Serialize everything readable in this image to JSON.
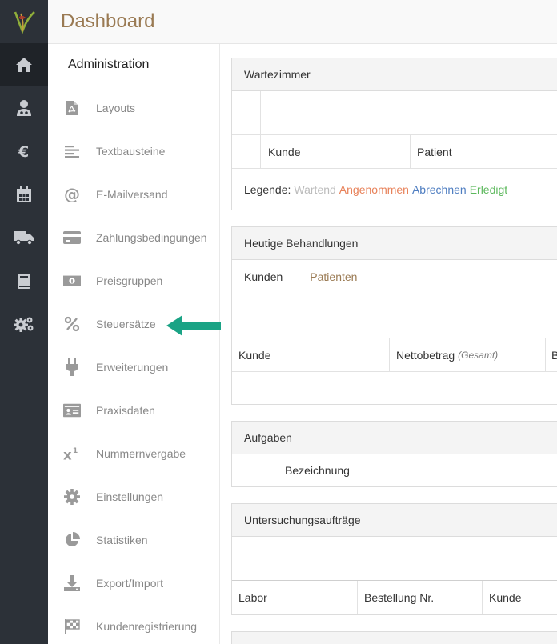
{
  "header": {
    "title": "Dashboard"
  },
  "submenu": {
    "heading": "Administration",
    "items": [
      {
        "label": "Layouts",
        "icon": "pdf-file-icon"
      },
      {
        "label": "Textbausteine",
        "icon": "text-lines-icon"
      },
      {
        "label": "E-Mailversand",
        "icon": "at-sign-icon"
      },
      {
        "label": "Zahlungsbedingungen",
        "icon": "credit-card-icon"
      },
      {
        "label": "Preisgruppen",
        "icon": "money-bill-icon"
      },
      {
        "label": "Steuersätze",
        "icon": "percent-icon"
      },
      {
        "label": "Erweiterungen",
        "icon": "plug-icon"
      },
      {
        "label": "Praxisdaten",
        "icon": "id-card-icon"
      },
      {
        "label": "Nummernvergabe",
        "icon": "superscript-icon"
      },
      {
        "label": "Einstellungen",
        "icon": "gear-icon"
      },
      {
        "label": "Statistiken",
        "icon": "pie-chart-icon"
      },
      {
        "label": "Export/Import",
        "icon": "download-icon"
      },
      {
        "label": "Kundenregistrierung",
        "icon": "checkered-flag-icon"
      }
    ]
  },
  "rail": [
    "logo-icon",
    "home-icon",
    "user-doctor-icon",
    "euro-icon",
    "calendar-icon",
    "truck-icon",
    "book-icon",
    "cogs-icon"
  ],
  "wartezimmer": {
    "title": "Wartezimmer",
    "columns": [
      "Kunde",
      "Patient"
    ],
    "legend_label": "Legende:",
    "legend": [
      {
        "text": "Wartend",
        "color": "#bbbbbb"
      },
      {
        "text": "Angenommen",
        "color": "#e8825a"
      },
      {
        "text": "Abrechnen",
        "color": "#4f7ec1"
      },
      {
        "text": "Erledigt",
        "color": "#5cb85c"
      }
    ]
  },
  "behandlungen": {
    "title": "Heutige Behandlungen",
    "tabs": [
      "Kunden",
      "Patienten"
    ],
    "columns": [
      "Kunde",
      "Nettobetrag",
      "B"
    ],
    "column_note": "(Gesamt)"
  },
  "aufgaben": {
    "title": "Aufgaben",
    "columns": [
      "Bezeichnung"
    ]
  },
  "untersuchung": {
    "title": "Untersuchungsaufträge",
    "columns": [
      "Labor",
      "Bestellung Nr.",
      "Kunde"
    ]
  },
  "colors": {
    "rail": "#2c3138",
    "accent": "#9a7a53",
    "arrow": "#1aa385"
  }
}
